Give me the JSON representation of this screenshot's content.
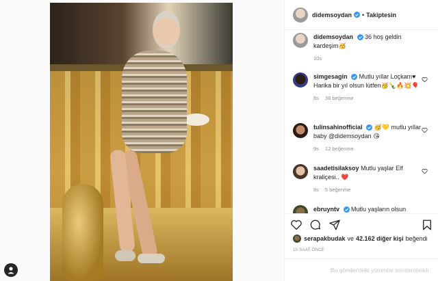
{
  "post": {
    "author": "didemsoydan",
    "verified": true,
    "follow_label": "Takiptesin",
    "separator": "•"
  },
  "caption": {
    "username": "didemsoydan",
    "text": "36 hoş geldin kardeşim🥳",
    "time": "10s"
  },
  "comments": [
    {
      "username": "simgesagin",
      "text": "Mutlu yıllar Loçkam♥ Harika bir yıl olsun lütfen🥳🍾🔥💥🎈",
      "time": "8s",
      "likes": "38 beğenme"
    },
    {
      "username": "tulinsahinofficial",
      "text": "🥳💛 mutlu yıllar baby @didemsoydan 😘",
      "time": "9s",
      "likes": "12 beğenme"
    },
    {
      "username": "saadetisilaksoy",
      "text": "Mutlu yaşlar Elf kraliçesi.. ❤️",
      "time": "8s",
      "likes": "5 beğenme"
    },
    {
      "username": "ebruyntv",
      "text": "Mutlu yaşların olsun"
    }
  ],
  "likes": {
    "liker": "serapakbudak",
    "connector": "ve",
    "others": "42.162 diğer kişi",
    "suffix": "beğendi"
  },
  "timestamp": "10 SAAT ÖNCE",
  "comments_limited": "Bu gönderideki yorumlar sınırlandırıldı.",
  "icons": [
    "heart-icon",
    "comment-icon",
    "share-icon",
    "bookmark-icon",
    "verified-icon",
    "profile-icon"
  ],
  "colors": {
    "verified": "#3897f0",
    "text": "#262626",
    "muted": "#8e8e8e"
  }
}
